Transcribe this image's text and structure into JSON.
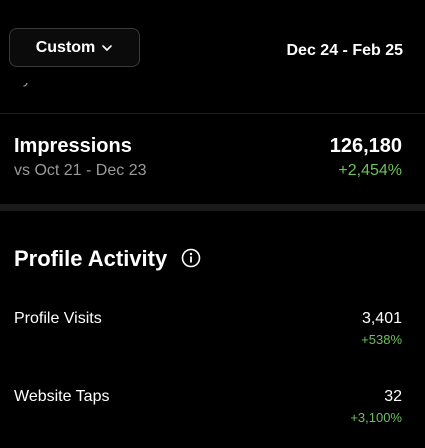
{
  "header": {
    "range_button_label": "Custom",
    "date_range": "Dec 24 - Feb 25"
  },
  "clipped_text": "by reach.",
  "impressions": {
    "title": "Impressions",
    "value": "126,180",
    "comparison": "vs Oct 21 - Dec 23",
    "change": "+2,454%"
  },
  "profile_activity": {
    "title": "Profile Activity",
    "rows": [
      {
        "label": "Profile Visits",
        "value": "3,401",
        "change": "+538%"
      },
      {
        "label": "Website Taps",
        "value": "32",
        "change": "+3,100%"
      }
    ]
  },
  "colors": {
    "background": "#000000",
    "positive_change": "#6cc05b",
    "secondary_text": "#9a9a9a"
  },
  "icons": [
    "chevron-down-icon",
    "info-icon"
  ]
}
